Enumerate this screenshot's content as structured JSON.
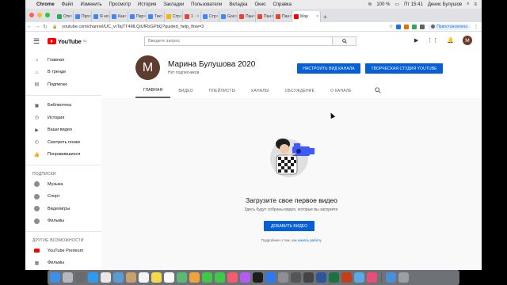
{
  "mac_menubar": {
    "items": [
      "Chrome",
      "Файл",
      "Изменить",
      "Просмотр",
      "История",
      "Закладки",
      "Пользователи",
      "Вкладка",
      "Окно",
      "Справка"
    ],
    "battery": "100 %",
    "clock": "Пт 15:41",
    "user": "Денис Булушов"
  },
  "browser": {
    "tabs": [
      {
        "label": "Отк",
        "color": "#34a853"
      },
      {
        "label": "Про",
        "color": "#4285f4"
      },
      {
        "label": "Я но",
        "color": "#4285f4"
      },
      {
        "label": "Как",
        "color": "#4285f4"
      },
      {
        "label": "Пер",
        "color": "#4285f4"
      },
      {
        "label": "Тек",
        "color": "#4285f4"
      },
      {
        "label": "Стр",
        "color": "#f4b400"
      },
      {
        "label": "1 ·",
        "color": "#ea4335"
      },
      {
        "label": "Стр",
        "color": "#4285f4"
      },
      {
        "label": "Goo",
        "color": "#4285f4"
      },
      {
        "label": "Пан",
        "color": "#ea4335"
      },
      {
        "label": "Пан",
        "color": "#ea4335"
      },
      {
        "label": "Пан",
        "color": "#ea4335"
      }
    ],
    "active_tab": "Мар",
    "url": "youtube.com/channel/UC_vrTajTT4MLQiUfRzGPbQ?guided_help_flow=3",
    "profile_label": "Приостановлена"
  },
  "youtube": {
    "logo_text": "YouTube",
    "logo_region": "RU",
    "search_placeholder": "Введите запрос",
    "header_avatar_letter": "M"
  },
  "sidebar": {
    "main": [
      {
        "label": "Главная",
        "icon": "home-icon"
      },
      {
        "label": "В тренде",
        "icon": "flame-icon"
      },
      {
        "label": "Подписки",
        "icon": "subscriptions-icon"
      }
    ],
    "library": [
      {
        "label": "Библиотека",
        "icon": "library-icon"
      },
      {
        "label": "История",
        "icon": "history-icon"
      },
      {
        "label": "Ваши видео",
        "icon": "your-videos-icon"
      },
      {
        "label": "Смотреть позже",
        "icon": "watch-later-icon"
      },
      {
        "label": "Понравившиеся",
        "icon": "like-icon"
      }
    ],
    "subscriptions_heading": "ПОДПИСКИ",
    "subscriptions": [
      {
        "label": "Музыка"
      },
      {
        "label": "Спорт"
      },
      {
        "label": "Видеоигры"
      },
      {
        "label": "Фильмы"
      }
    ],
    "more_heading": "ДРУГИЕ ВОЗМОЖНОСТИ",
    "more": [
      {
        "label": "YouTube Premium"
      },
      {
        "label": "Фильмы"
      }
    ]
  },
  "channel": {
    "avatar_letter": "M",
    "name": "Марина Булушова 2020",
    "subscribers": "Нет подписчиков",
    "customize_button": "НАСТРОИТЬ ВИД КАНАЛА",
    "studio_button": "ТВОРЧЕСКАЯ СТУДИЯ YOUTUBE",
    "tabs": [
      "ГЛАВНАЯ",
      "ВИДЕО",
      "ПЛЕЙЛИСТЫ",
      "КАНАЛЫ",
      "ОБСУЖДЕНИЕ",
      "О КАНАЛЕ"
    ],
    "active_tab_index": 0
  },
  "empty_state": {
    "title": "Загрузите свое первое видео",
    "subtitle": "Здесь будут собраны видео, которые вы загрузите.",
    "button": "ДОБАВИТЬ ВИДЕО",
    "learn_more_prefix": "Подробнее о том, как ",
    "learn_more_link": "начать работу",
    "learn_more_suffix": "."
  },
  "colors": {
    "brand_red": "#ff0000",
    "primary_blue": "#065fd4",
    "content_bg": "#f9f9f9"
  }
}
